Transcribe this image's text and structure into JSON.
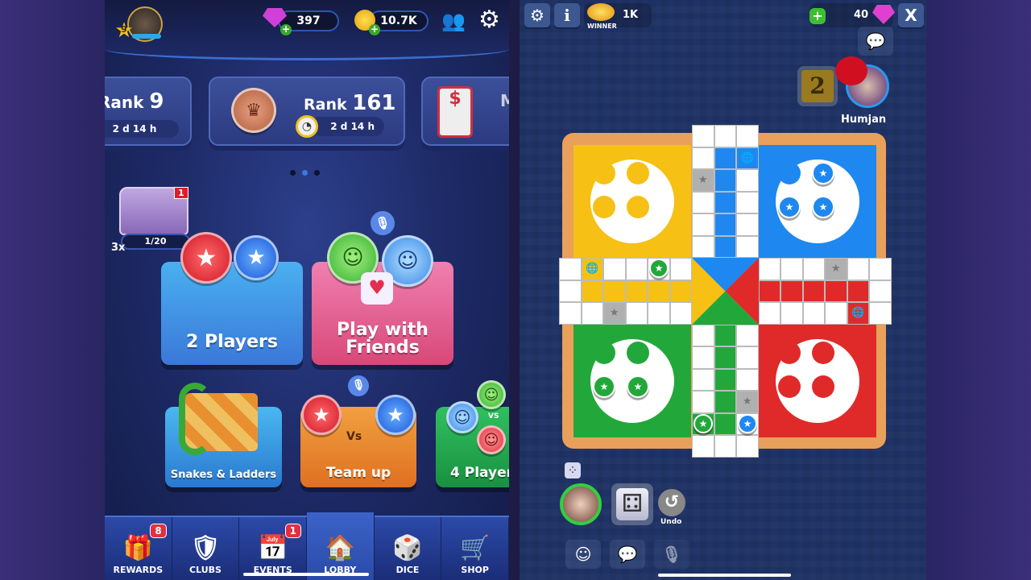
{
  "lobby": {
    "header": {
      "level": "9",
      "gems": "397",
      "coins": "10.7K",
      "friends_icon": "friends-icon",
      "settings_icon": "gear-icon"
    },
    "rank_cards": [
      {
        "label": "Rank",
        "value": "9",
        "timer": "2 d 14 h"
      },
      {
        "label": "Rank",
        "value": "161",
        "timer": "2 d 14 h"
      },
      {
        "label": "M",
        "value": "",
        "timer": ""
      }
    ],
    "carousel": {
      "pages": 3,
      "active": 2
    },
    "chest": {
      "badge": "1",
      "progress": "1/20",
      "multiplier": "3x"
    },
    "modes": [
      {
        "label": "2 Players"
      },
      {
        "label": "Play with Friends"
      },
      {
        "label": "Snakes & Ladders"
      },
      {
        "label": "Team up",
        "vs": "Vs"
      },
      {
        "label": "4 Players",
        "vs": "VS"
      }
    ],
    "nav": [
      {
        "label": "REWARDS",
        "icon": "gift-icon",
        "badge": "8"
      },
      {
        "label": "CLUBS",
        "icon": "shield-icon"
      },
      {
        "label": "EVENTS",
        "icon": "calendar-trophy-icon",
        "badge": "1"
      },
      {
        "label": "LOBBY",
        "icon": "home-icon",
        "active": true
      },
      {
        "label": "DICE",
        "icon": "dice-icon"
      },
      {
        "label": "SHOP",
        "icon": "cart-icon"
      }
    ]
  },
  "game": {
    "winner_label": "WINNER",
    "prize": "1K",
    "gems": "40",
    "close_label": "X",
    "info_label": "i",
    "opponent": {
      "name": "Humjan",
      "dice_value": "2"
    },
    "player": {
      "dice_value": 4
    },
    "undo_label": "Undo",
    "colors": {
      "yellow": "#f6c114",
      "blue": "#1e88f0",
      "red": "#e02a2a",
      "green": "#22a83a",
      "frame": "#e9a05a",
      "star_cell": "#b0b0b0"
    },
    "yards": {
      "yellow": {
        "pieces_home": 0
      },
      "blue": {
        "pieces_home": 3
      },
      "green": {
        "pieces_home": 2
      },
      "red": {
        "pieces_home": 0
      }
    }
  }
}
